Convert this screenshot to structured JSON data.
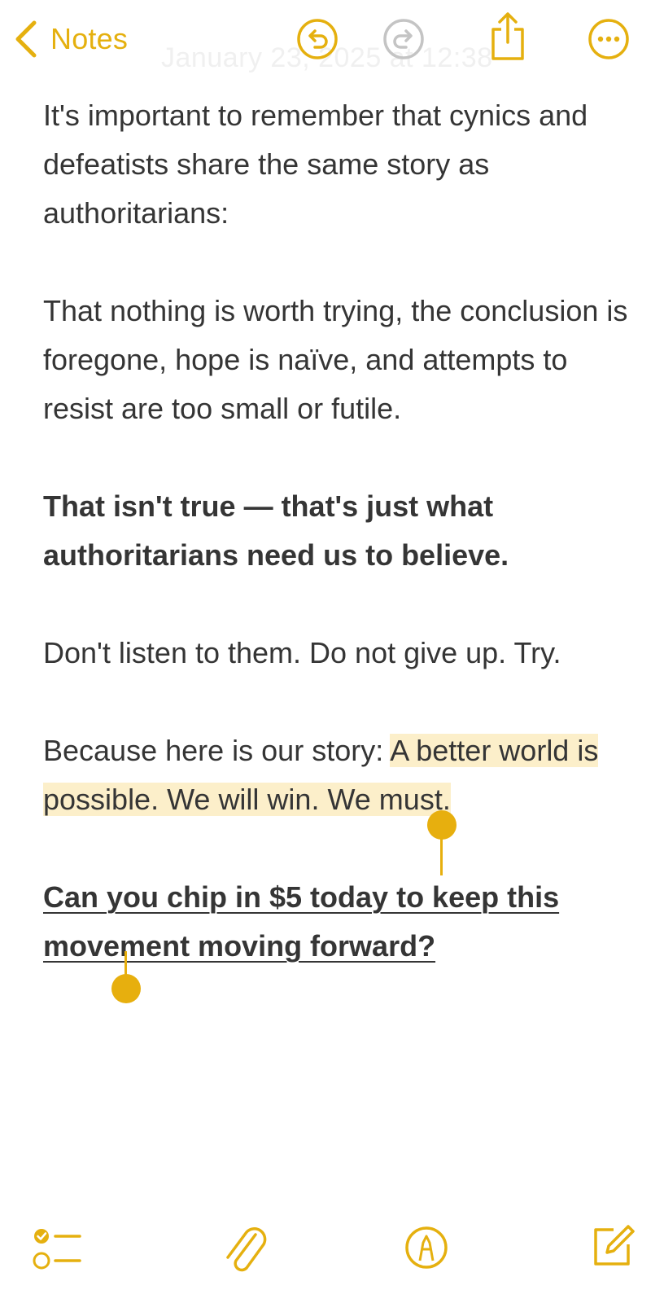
{
  "header": {
    "back_label": "Notes",
    "date_ghost": "January 23, 2025 at 12:38",
    "icons": {
      "back": "chevron-left-icon",
      "undo": "undo-icon",
      "redo": "redo-icon",
      "share": "share-icon",
      "more": "more-icon"
    }
  },
  "note": {
    "p1": "It's important to remember that cynics and defeatists share the same story as authoritarians:",
    "p2": "That nothing is worth trying, the conclusion is foregone, hope is naïve, and attempts to resist are too small or futile.",
    "p3": "That isn't true — that's just what authoritarians need us to believe.",
    "p4": "Don't listen to them. Do not give up. Try.",
    "p5_plain": "Because here is our story: ",
    "p5_selected": "A better world is possible. We will win. We must.",
    "p6_link": "Can you chip in $5 today to keep this movement moving forward?"
  },
  "bottom_toolbar": {
    "icons": {
      "checklist": "checklist-icon",
      "attachment": "paperclip-icon",
      "markup": "markup-pen-icon",
      "compose": "compose-icon"
    }
  },
  "colors": {
    "accent": "#E5B00F",
    "selection": "#FCEFCA",
    "disabled": "#C4C4C4",
    "text": "#353535"
  }
}
